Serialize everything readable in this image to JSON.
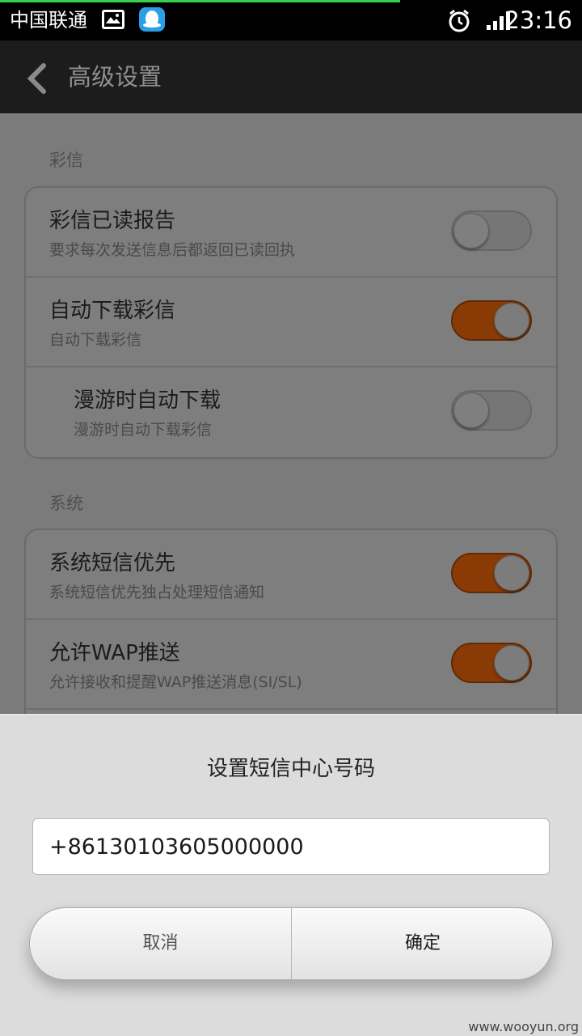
{
  "status_bar": {
    "carrier": "中国联通",
    "time": "23:16",
    "icons": [
      "gallery-icon",
      "qq-icon",
      "alarm-icon",
      "signal-icon"
    ]
  },
  "action_bar": {
    "title": "高级设置"
  },
  "sections": [
    {
      "header": "彩信",
      "items": [
        {
          "title": "彩信已读报告",
          "subtitle": "要求每次发送信息后都返回已读回执",
          "enabled": false
        },
        {
          "title": "自动下载彩信",
          "subtitle": "自动下载彩信",
          "enabled": true
        },
        {
          "title": "漫游时自动下载",
          "subtitle": "漫游时自动下载彩信",
          "enabled": false
        }
      ]
    },
    {
      "header": "系统",
      "items": [
        {
          "title": "系统短信优先",
          "subtitle": "系统短信优先独占处理短信通知",
          "enabled": true
        },
        {
          "title": "允许WAP推送",
          "subtitle": "允许接收和提醒WAP推送消息(SI/SL)",
          "enabled": true
        }
      ]
    }
  ],
  "dialog": {
    "title": "设置短信中心号码",
    "input_value": "+8613010360500000 0",
    "cancel_label": "取消",
    "ok_label": "确定"
  },
  "watermark": "www.wooyun.org",
  "colors": {
    "toggle_on": "#8a3b05",
    "statusbar_bg": "#000000",
    "actionbar_bg": "#1c1c1c",
    "dialog_bg": "#dcdcdc"
  }
}
